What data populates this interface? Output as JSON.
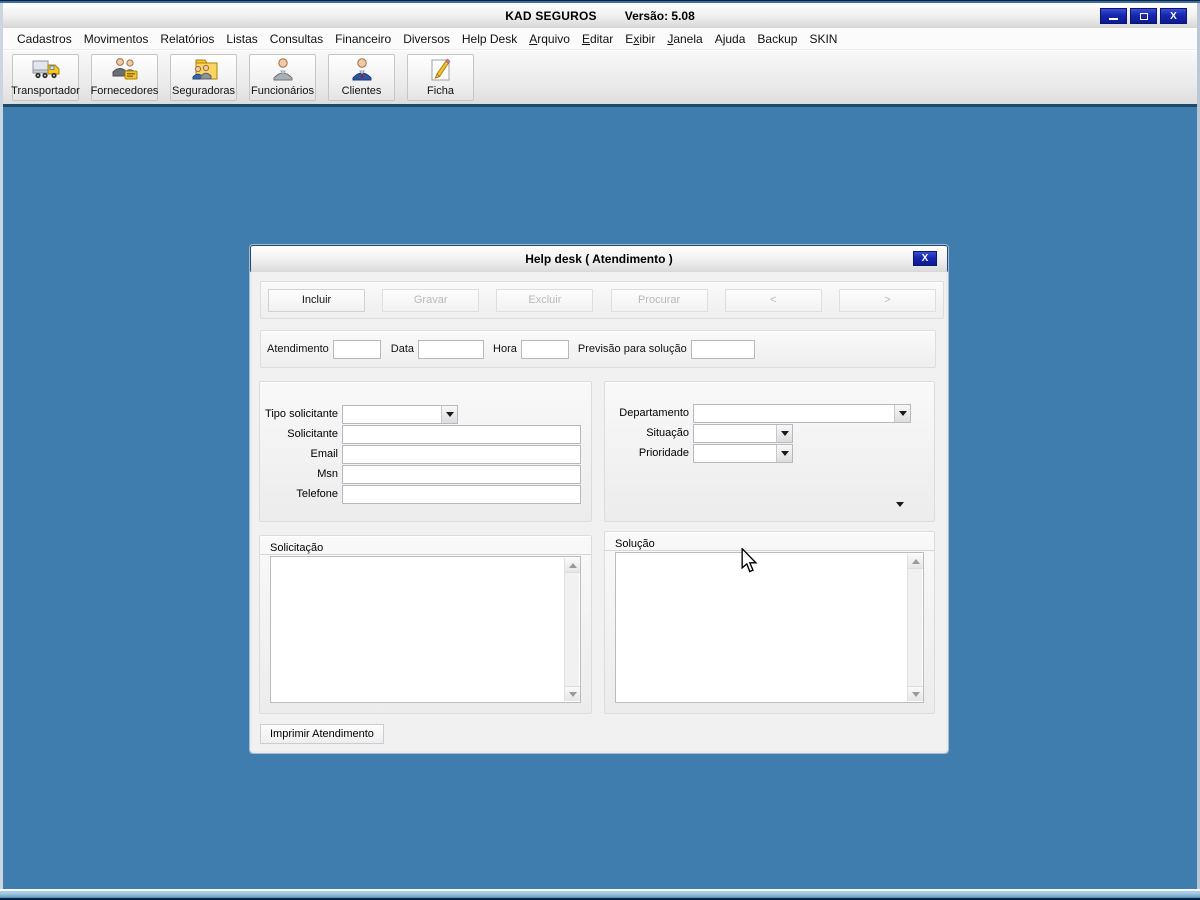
{
  "window": {
    "title": "KAD SEGUROS",
    "version": "Versão: 5.08",
    "controls": {
      "minimize": "",
      "maximize": "",
      "close": "X"
    }
  },
  "menu": {
    "items": [
      {
        "label": "Cadastros",
        "u": -1
      },
      {
        "label": "Movimentos",
        "u": -1
      },
      {
        "label": "Relatórios",
        "u": -1
      },
      {
        "label": "Listas",
        "u": -1
      },
      {
        "label": "Consultas",
        "u": -1
      },
      {
        "label": "Financeiro",
        "u": -1
      },
      {
        "label": "Diversos",
        "u": -1
      },
      {
        "label": "Help Desk",
        "u": -1
      },
      {
        "label": "Arquivo",
        "u": 0
      },
      {
        "label": "Editar",
        "u": 0
      },
      {
        "label": "Exibir",
        "u": 1
      },
      {
        "label": "Janela",
        "u": 0
      },
      {
        "label": "Ajuda",
        "u": -1
      },
      {
        "label": "Backup",
        "u": -1
      },
      {
        "label": "SKIN",
        "u": -1
      }
    ]
  },
  "toolbar": {
    "buttons": [
      {
        "label": "Transportador",
        "icon": "truck-icon"
      },
      {
        "label": "Fornecedores",
        "icon": "suppliers-icon"
      },
      {
        "label": "Seguradoras",
        "icon": "insurers-folder-icon"
      },
      {
        "label": "Funcionários",
        "icon": "employee-icon"
      },
      {
        "label": "Clientes",
        "icon": "client-icon"
      },
      {
        "label": "Ficha",
        "icon": "record-sheet-icon"
      }
    ]
  },
  "dialog": {
    "title": "Help desk ( Atendimento )",
    "close": "X",
    "actions": [
      {
        "label": "Incluir",
        "enabled": true
      },
      {
        "label": "Gravar",
        "enabled": false
      },
      {
        "label": "Excluir",
        "enabled": false
      },
      {
        "label": "Procurar",
        "enabled": false
      },
      {
        "label": "<",
        "enabled": false
      },
      {
        "label": ">",
        "enabled": false
      }
    ],
    "header": {
      "atendimento": {
        "label": "Atendimento",
        "value": ""
      },
      "data": {
        "label": "Data",
        "value": ""
      },
      "hora": {
        "label": "Hora",
        "value": ""
      },
      "previsao": {
        "label": "Previsão para solução",
        "value": ""
      }
    },
    "requester": {
      "tipo_solicitante": {
        "label": "Tipo solicitante",
        "value": ""
      },
      "solicitante": {
        "label": "Solicitante",
        "value": ""
      },
      "email": {
        "label": "Email",
        "value": ""
      },
      "msn": {
        "label": "Msn",
        "value": ""
      },
      "telefone": {
        "label": "Telefone",
        "value": ""
      }
    },
    "classification": {
      "departamento": {
        "label": "Departamento",
        "value": ""
      },
      "situacao": {
        "label": "Situação",
        "value": ""
      },
      "prioridade": {
        "label": "Prioridade",
        "value": ""
      }
    },
    "solicitacao": {
      "label": "Solicitação",
      "value": ""
    },
    "solucao": {
      "label": "Solução",
      "value": ""
    },
    "print_button": "Imprimir Atendimento"
  },
  "colors": {
    "desktop_blue": "#3e7dad",
    "frame_navy": "#0a2342",
    "frame_blue": "#3a6f9f",
    "control_button_navy": "#1527ae",
    "toolbar_edge": "#1c4a68",
    "disabled_text": "#b9b9b9"
  }
}
